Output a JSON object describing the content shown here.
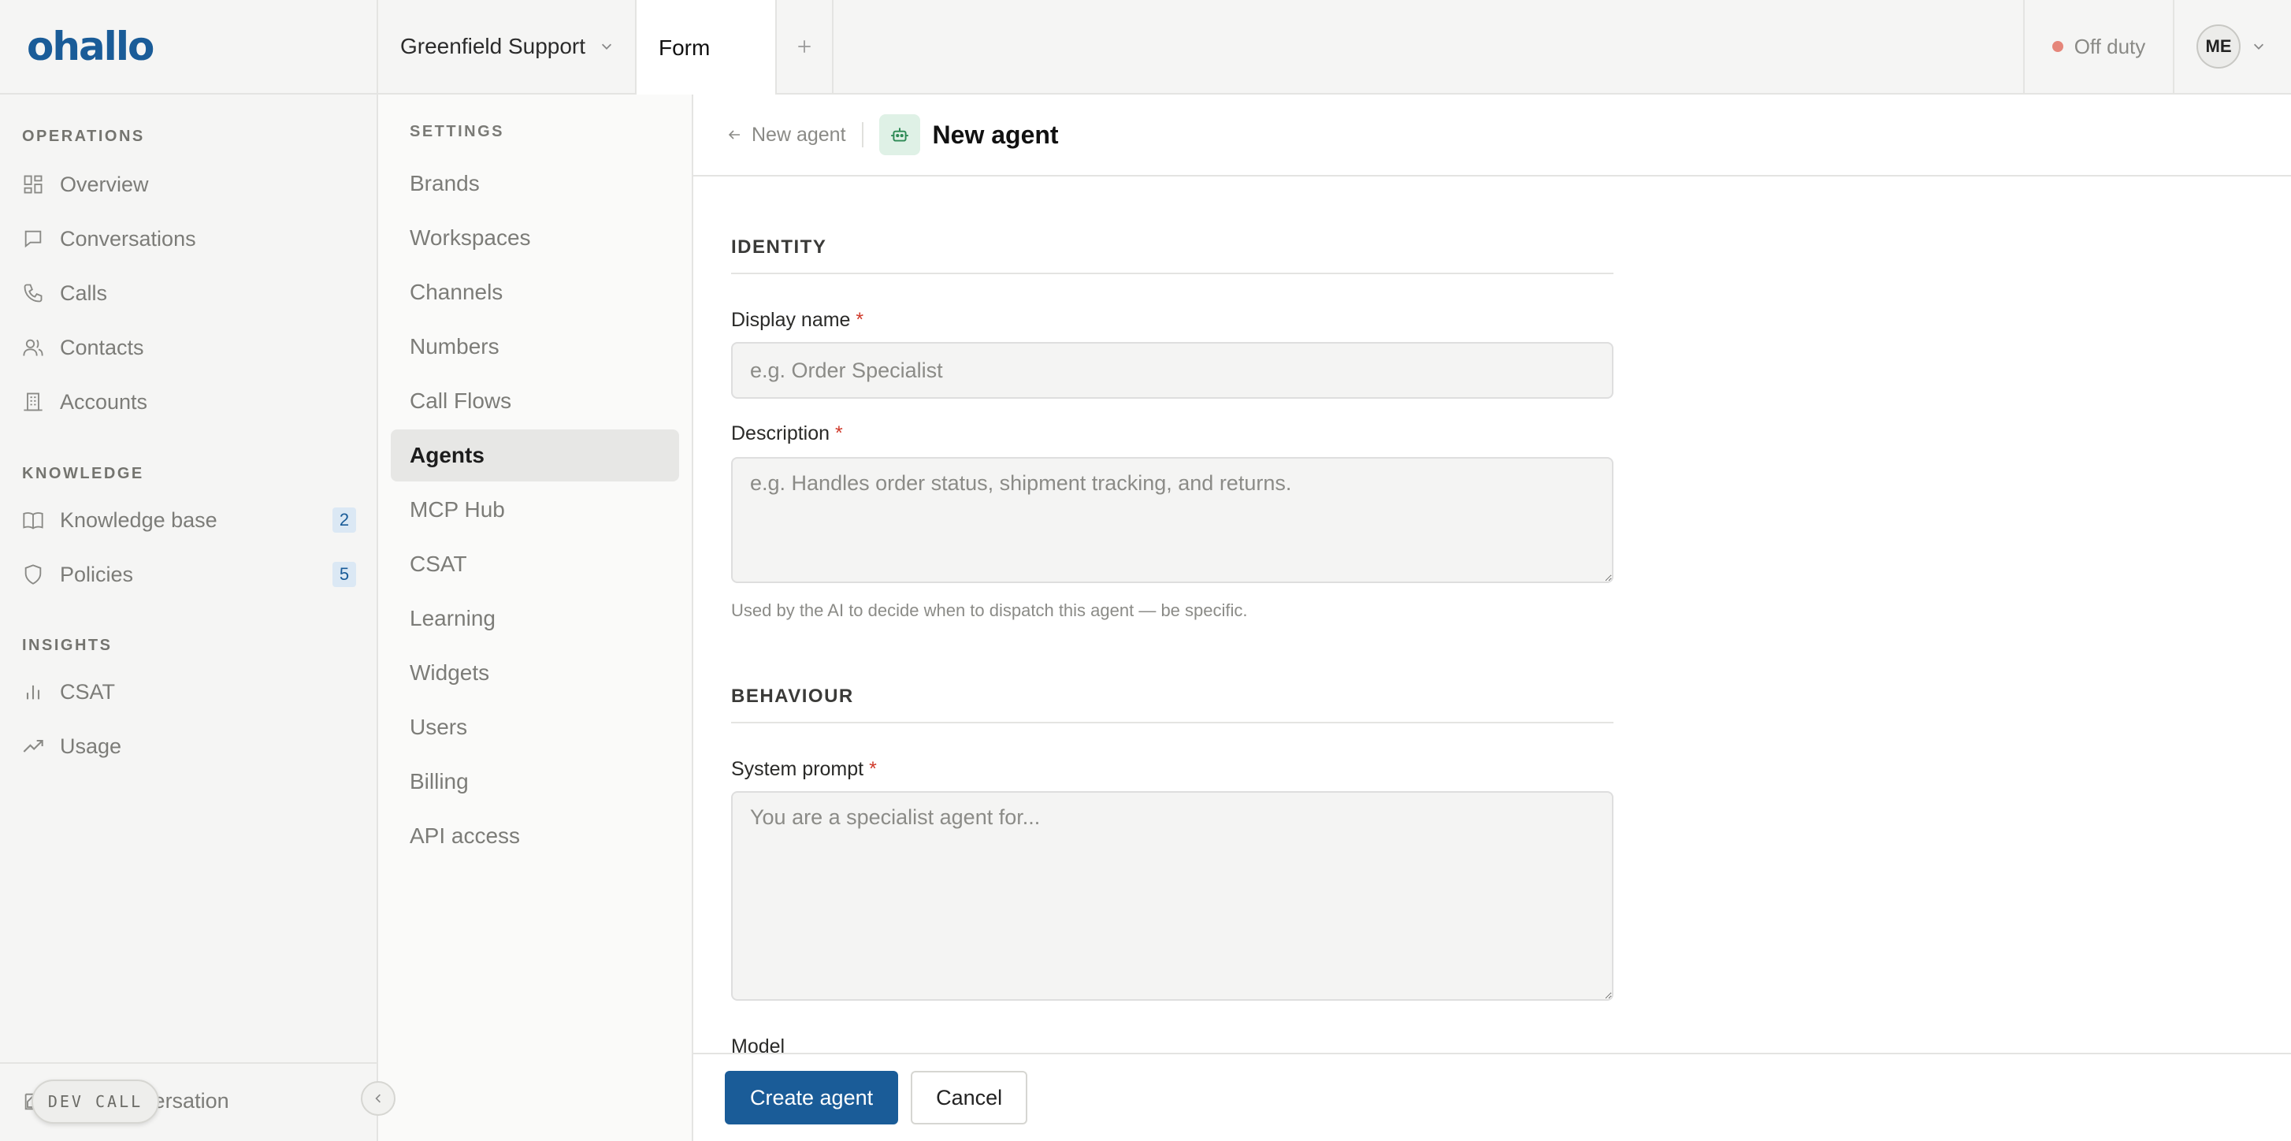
{
  "app": {
    "logo": "ohallo"
  },
  "topbar": {
    "workspace": "Greenfield Support",
    "tab_form": "Form",
    "duty_status": "Off duty",
    "user_initials": "ME"
  },
  "sidebar": {
    "sections": [
      {
        "label": "OPERATIONS"
      },
      {
        "label": "KNOWLEDGE"
      },
      {
        "label": "INSIGHTS"
      }
    ],
    "items": [
      {
        "label": "Overview",
        "icon": "grid-icon"
      },
      {
        "label": "Conversations",
        "icon": "chat-icon"
      },
      {
        "label": "Calls",
        "icon": "phone-icon"
      },
      {
        "label": "Contacts",
        "icon": "users-icon"
      },
      {
        "label": "Accounts",
        "icon": "building-icon"
      },
      {
        "label": "Knowledge base",
        "icon": "book-icon",
        "badge": "2"
      },
      {
        "label": "Policies",
        "icon": "shield-icon",
        "badge": "5"
      },
      {
        "label": "CSAT",
        "icon": "bar-chart-icon"
      },
      {
        "label": "Usage",
        "icon": "trend-icon"
      }
    ],
    "footer_link": "New conversation",
    "dev_pill": "DEV CALL"
  },
  "settings": {
    "title": "SETTINGS",
    "items": [
      "Brands",
      "Workspaces",
      "Channels",
      "Numbers",
      "Call Flows",
      "Agents",
      "MCP Hub",
      "CSAT",
      "Learning",
      "Widgets",
      "Users",
      "Billing",
      "API access"
    ],
    "active": "Agents"
  },
  "main": {
    "back_label": "New agent",
    "title": "New agent",
    "sections": {
      "identity": "IDENTITY",
      "behaviour": "BEHAVIOUR"
    },
    "fields": {
      "display_name": {
        "label": "Display name",
        "required": "*",
        "value": "",
        "placeholder": "e.g. Order Specialist"
      },
      "description": {
        "label": "Description",
        "required": "*",
        "value": "",
        "placeholder": "e.g. Handles order status, shipment tracking, and returns.",
        "hint": "Used by the AI to decide when to dispatch this agent — be specific."
      },
      "system_prompt": {
        "label": "System prompt",
        "required": "*",
        "value": "",
        "placeholder": "You are a specialist agent for..."
      },
      "model": {
        "label": "Model"
      }
    },
    "buttons": {
      "create": "Create agent",
      "cancel": "Cancel"
    }
  },
  "colors": {
    "accent": "#1a5c98",
    "required": "#d03a2b",
    "off_duty": "#e5867a",
    "agent_icon_bg": "#dff1e6"
  }
}
